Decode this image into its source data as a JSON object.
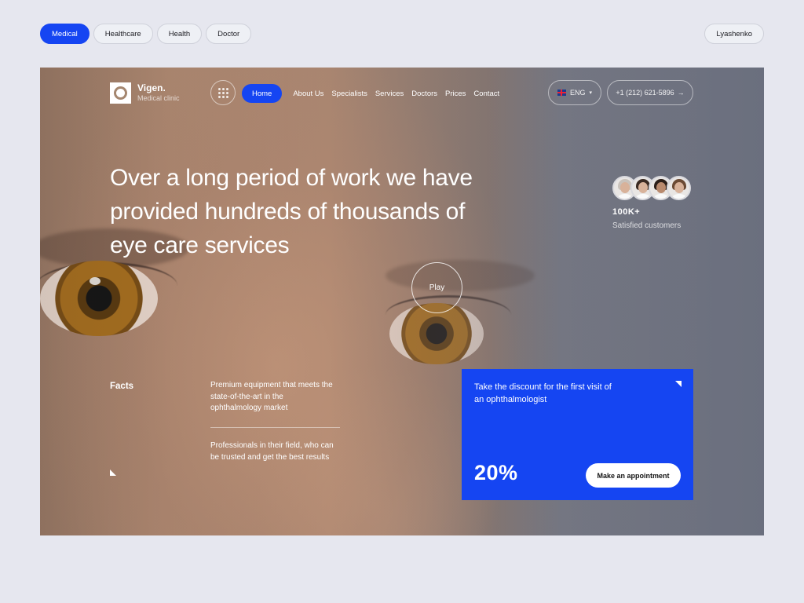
{
  "tags": [
    {
      "label": "Medical",
      "active": true
    },
    {
      "label": "Healthcare",
      "active": false
    },
    {
      "label": "Health",
      "active": false
    },
    {
      "label": "Doctor",
      "active": false
    }
  ],
  "author": "Lyashenko",
  "brand": {
    "name": "Vigen.",
    "subtitle": "Medical clinic"
  },
  "nav": {
    "home": "Home",
    "links": [
      "About Us",
      "Specialists",
      "Services",
      "Doctors",
      "Prices",
      "Contact"
    ]
  },
  "language": {
    "label": "ENG",
    "icon": "uk-flag-icon",
    "caret": "▾"
  },
  "phone": {
    "number": "+1 (212) 621-5896",
    "arrow": "→"
  },
  "headline": "Over a long period of work we have provided hundreds of thousands of eye care services",
  "customers": {
    "count": "100K+",
    "label": "Satisfied customers",
    "avatar_count": 4
  },
  "play_label": "Play",
  "facts": {
    "title": "Facts",
    "items": [
      "Premium equipment that meets the state-of-the-art in the ophthalmology market",
      "Professionals in their field, who can be trusted and get the best results"
    ]
  },
  "promo": {
    "text": "Take the discount for the first visit of an ophthalmologist",
    "discount": "20%",
    "button": "Make an appointment"
  },
  "colors": {
    "accent": "#1545f2",
    "page_bg": "#e6e7ef"
  }
}
